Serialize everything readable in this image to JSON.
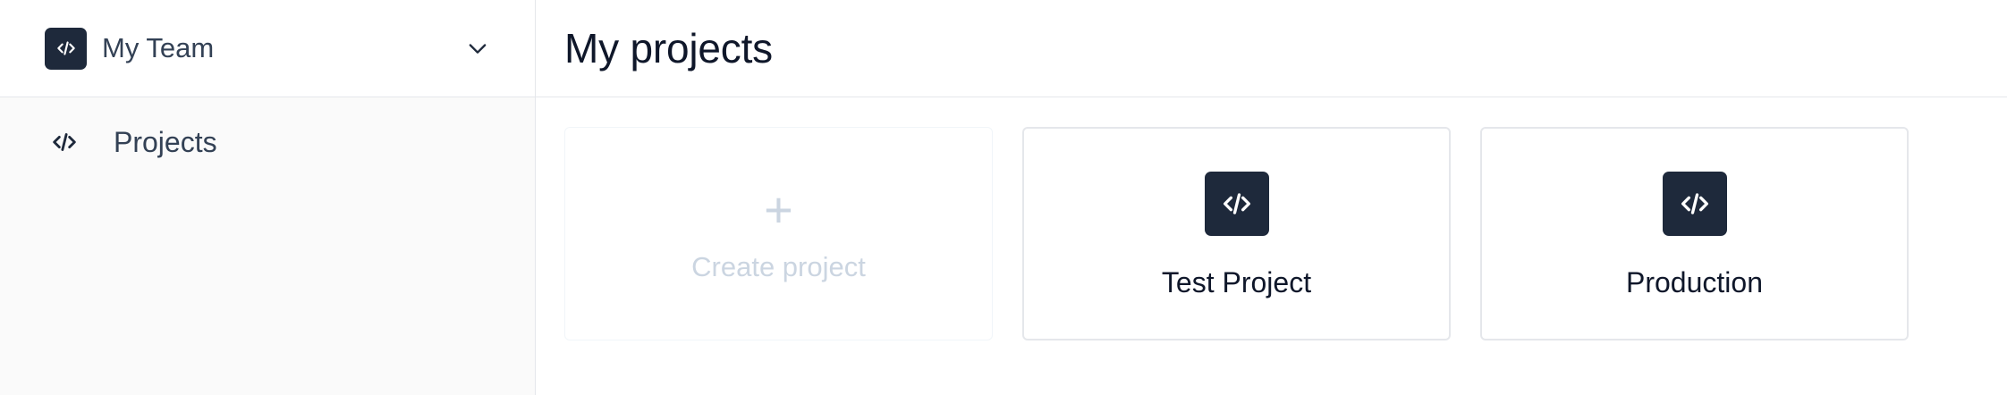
{
  "sidebar": {
    "team": {
      "name": "My Team",
      "logo_icon": "code-icon",
      "dropdown_icon": "chevron-down-icon"
    },
    "items": [
      {
        "label": "Projects",
        "icon": "code-icon"
      }
    ]
  },
  "header": {
    "title": "My projects"
  },
  "cards": {
    "create": {
      "label": "Create project",
      "icon": "plus-icon"
    },
    "projects": [
      {
        "name": "Test Project",
        "icon": "code-icon"
      },
      {
        "name": "Production",
        "icon": "code-icon"
      }
    ]
  },
  "colors": {
    "dark": "#1e293b",
    "muted": "#cbd5e1",
    "border": "#e5e7eb",
    "sidebar_bg": "#fafafa"
  }
}
